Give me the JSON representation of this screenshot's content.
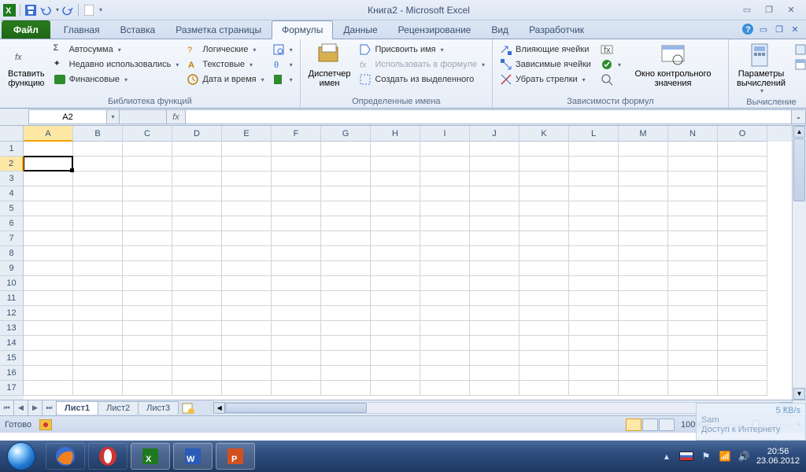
{
  "title": "Книга2  -  Microsoft Excel",
  "qat": {
    "save": "save-icon",
    "undo": "undo-icon",
    "redo": "redo-icon"
  },
  "tabs": {
    "file": "Файл",
    "items": [
      "Главная",
      "Вставка",
      "Разметка страницы",
      "Формулы",
      "Данные",
      "Рецензирование",
      "Вид",
      "Разработчик"
    ],
    "active_index": 3
  },
  "ribbon": {
    "group_function_library": {
      "label": "Библиотека функций",
      "insert_function": "Вставить функцию",
      "autosum": "Автосумма",
      "recent": "Недавно использовались",
      "financial": "Финансовые",
      "logical": "Логические",
      "text": "Текстовые",
      "datetime": "Дата и время",
      "lookup": "lookup-icon",
      "math": "math-icon",
      "more": "more-icon"
    },
    "group_defined_names": {
      "label": "Определенные имена",
      "name_manager": "Диспетчер имен",
      "define_name": "Присвоить имя",
      "use_in_formula": "Использовать в формуле",
      "create_from_selection": "Создать из выделенного"
    },
    "group_formula_auditing": {
      "label": "Зависимости формул",
      "trace_precedents": "Влияющие ячейки",
      "trace_dependents": "Зависимые ячейки",
      "remove_arrows": "Убрать стрелки",
      "show_formulas": "show-formulas-icon",
      "error_check": "error-check-icon",
      "evaluate": "evaluate-icon",
      "watch_window": "Окно контрольного значения"
    },
    "group_calculation": {
      "label": "Вычисление",
      "calc_options": "Параметры вычислений",
      "calc_now": "calc-now-icon",
      "calc_sheet": "calc-sheet-icon"
    }
  },
  "namebox": {
    "value": "A2"
  },
  "columns": [
    "A",
    "B",
    "C",
    "D",
    "E",
    "F",
    "G",
    "H",
    "I",
    "J",
    "K",
    "L",
    "M",
    "N",
    "O"
  ],
  "rows": [
    1,
    2,
    3,
    4,
    5,
    6,
    7,
    8,
    9,
    10,
    11,
    12,
    13,
    14,
    15,
    16,
    17
  ],
  "selection": {
    "col": 0,
    "row": 1
  },
  "sheets": {
    "items": [
      "Лист1",
      "Лист2",
      "Лист3"
    ],
    "active_index": 0
  },
  "status": {
    "ready": "Готово",
    "zoom": "100%"
  },
  "net_overlay": {
    "speed": "5 КВ/s",
    "user": "Sam",
    "text": "Доступ к Интернету"
  },
  "taskbar": {
    "apps": [
      "firefox",
      "opera",
      "excel",
      "word",
      "powerpoint"
    ],
    "running": [
      2,
      3,
      4
    ],
    "time": "20:56",
    "date": "23.06.2012"
  }
}
